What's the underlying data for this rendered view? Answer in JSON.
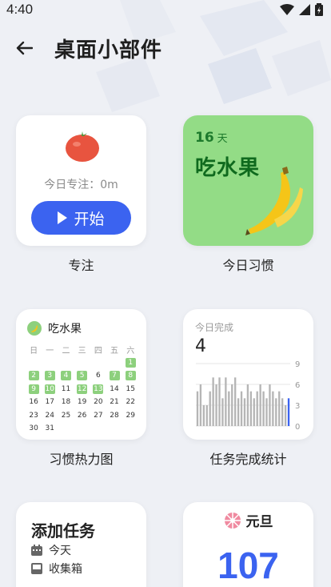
{
  "status_bar": {
    "time": "4:40"
  },
  "header": {
    "title": "桌面小部件"
  },
  "widgets": {
    "focus": {
      "today_text": "今日专注：0m",
      "start_label": "开始",
      "caption": "专注"
    },
    "habit": {
      "days": "16",
      "days_unit": "天",
      "name": "吃水果",
      "caption": "今日习惯"
    },
    "heatmap": {
      "name": "吃水果",
      "weekdays": [
        "日",
        "一",
        "二",
        "三",
        "四",
        "五",
        "六"
      ],
      "caption": "习惯热力图",
      "days": [
        {
          "d": "",
          "on": false
        },
        {
          "d": "",
          "on": false
        },
        {
          "d": "",
          "on": false
        },
        {
          "d": "",
          "on": false
        },
        {
          "d": "",
          "on": false
        },
        {
          "d": "",
          "on": false
        },
        {
          "d": "1",
          "on": true
        },
        {
          "d": "2",
          "on": true
        },
        {
          "d": "3",
          "on": true
        },
        {
          "d": "4",
          "on": true
        },
        {
          "d": "5",
          "on": true
        },
        {
          "d": "6",
          "on": false
        },
        {
          "d": "7",
          "on": true
        },
        {
          "d": "8",
          "on": true
        },
        {
          "d": "9",
          "on": true
        },
        {
          "d": "10",
          "on": true
        },
        {
          "d": "11",
          "on": false
        },
        {
          "d": "12",
          "on": true
        },
        {
          "d": "13",
          "on": true
        },
        {
          "d": "14",
          "on": false
        },
        {
          "d": "15",
          "on": false
        },
        {
          "d": "16",
          "on": false
        },
        {
          "d": "17",
          "on": false
        },
        {
          "d": "18",
          "on": false
        },
        {
          "d": "19",
          "on": false
        },
        {
          "d": "20",
          "on": false
        },
        {
          "d": "21",
          "on": false
        },
        {
          "d": "22",
          "on": false
        },
        {
          "d": "23",
          "on": false
        },
        {
          "d": "24",
          "on": false
        },
        {
          "d": "25",
          "on": false
        },
        {
          "d": "26",
          "on": false
        },
        {
          "d": "27",
          "on": false
        },
        {
          "d": "28",
          "on": false
        },
        {
          "d": "29",
          "on": false
        },
        {
          "d": "30",
          "on": false
        },
        {
          "d": "31",
          "on": false
        }
      ]
    },
    "stats": {
      "label": "今日完成",
      "count": "4",
      "caption": "任务完成统计",
      "chart_data": {
        "type": "bar",
        "yticks": [
          "9",
          "6",
          "3",
          "0"
        ],
        "ylim": [
          0,
          9
        ],
        "values": [
          5,
          6,
          3,
          3,
          5,
          7,
          6,
          7,
          4,
          7,
          5,
          6,
          7,
          4,
          5,
          4,
          6,
          5,
          4,
          5,
          6,
          5,
          4,
          6,
          5,
          4,
          5,
          4,
          3,
          4
        ],
        "highlight_index": 29,
        "bar_color": "#b5b5b5",
        "highlight_color": "#3b63f0"
      }
    },
    "add_task": {
      "title": "添加任务",
      "row1": "今天",
      "row2": "收集箱"
    },
    "countdown": {
      "name": "元旦",
      "days": "107"
    }
  }
}
